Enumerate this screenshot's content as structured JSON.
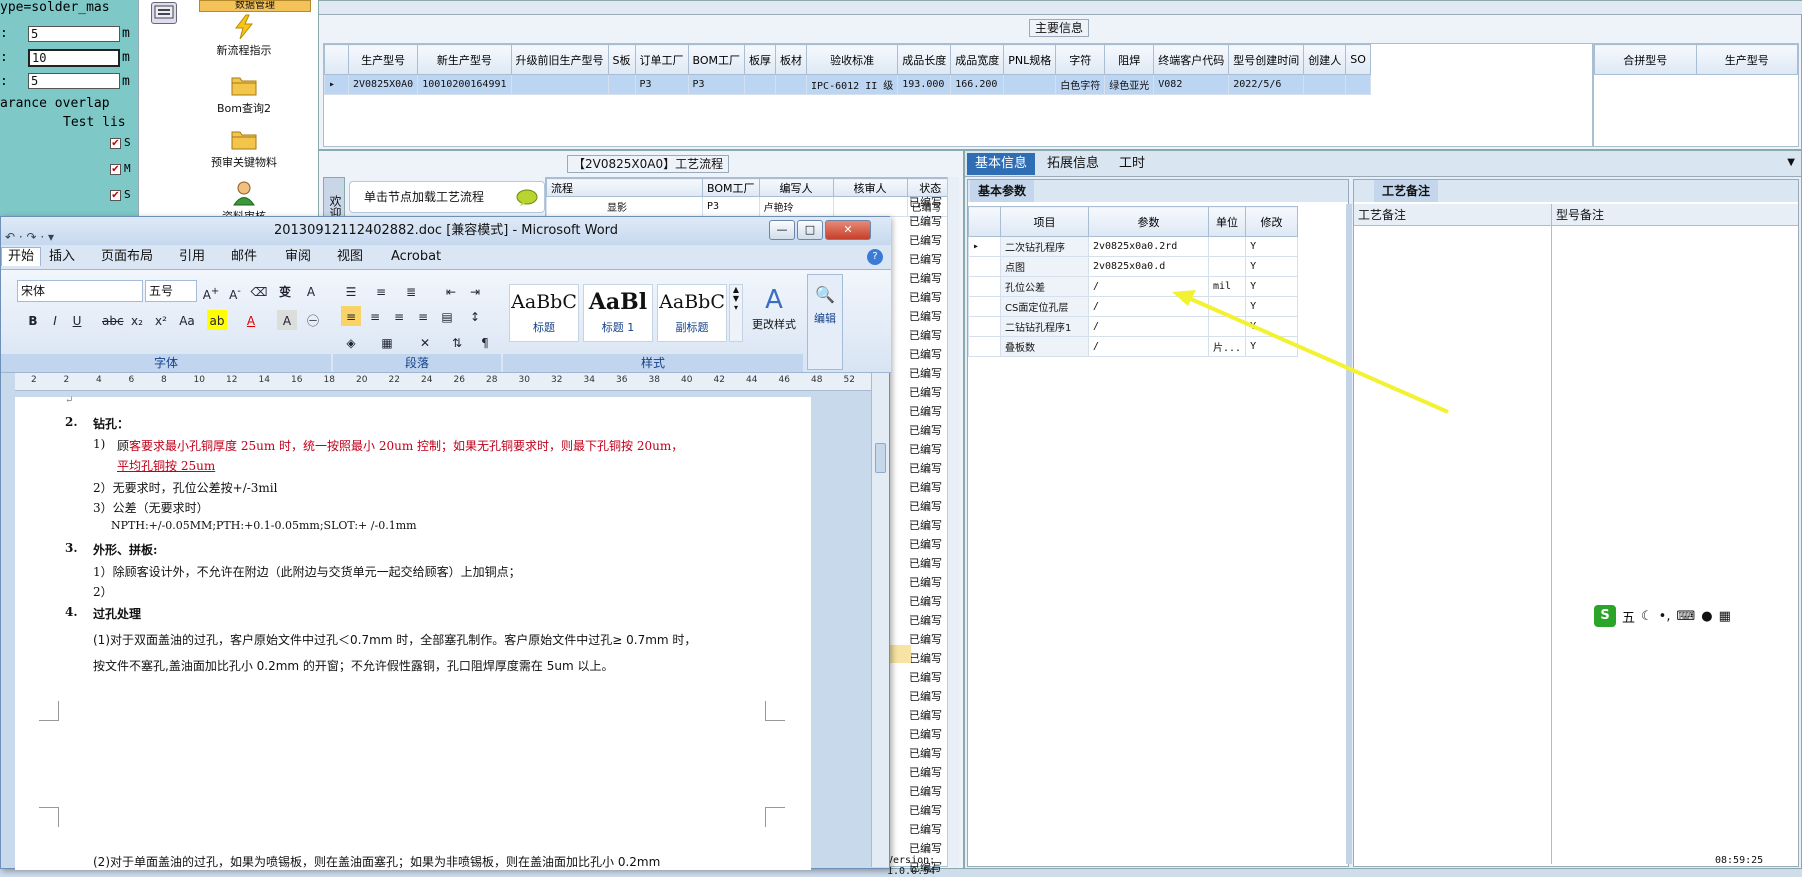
{
  "left_panel": {
    "top_line": "ype=solder_mas",
    "rows": [
      {
        "prefix": ":",
        "value": "5",
        "unit": "m"
      },
      {
        "prefix": ":",
        "value": "10",
        "unit": "m"
      },
      {
        "prefix": ":",
        "value": "5",
        "unit": "m"
      }
    ],
    "line_clearance": "arance overlap",
    "line_test": "Test lis",
    "checks": [
      "S",
      "M",
      "S"
    ]
  },
  "icon_column": {
    "header": "数据管理",
    "items": [
      "新流程指示",
      "Bom查询2",
      "预审关键物料",
      "资料审核"
    ]
  },
  "main_info": {
    "legend": "主要信息",
    "columns": [
      "生产型号",
      "新生产型号",
      "升级前旧生产型号",
      "S板",
      "订单工厂",
      "BOM工厂",
      "板厚",
      "板材",
      "验收标准",
      "成品长度",
      "成品宽度",
      "PNL规格",
      "字符",
      "阻焊",
      "终端客户代码",
      "型号创建时间",
      "创建人",
      "SO"
    ],
    "row": [
      "2V0825X0A0",
      "10010200164991",
      "",
      "",
      "P3",
      "P3",
      "",
      "",
      "IPC-6012 II 级",
      "193.000",
      "166.200",
      "",
      "白色字符",
      "绿色亚光",
      "V082",
      "2022/5/6",
      "",
      ""
    ],
    "side_columns": [
      "合拼型号",
      "生产型号"
    ]
  },
  "process": {
    "title": "【2V0825X0A0】工艺流程",
    "side_label": "欢迎",
    "load_button": "单击节点加载工艺流程",
    "columns": [
      "流程",
      "BOM工厂",
      "编写人",
      "核审人",
      "状态"
    ],
    "rows": [
      {
        "flow": "显影",
        "bom": "P3",
        "writer": "卢艳玲"
      }
    ],
    "status": "已编写",
    "version": "Version: 1.0.0.54"
  },
  "info_tabs": [
    "基本信息",
    "拓展信息",
    "工时"
  ],
  "basic_params": {
    "tab": "基本参数",
    "columns": [
      "项目",
      "参数",
      "单位",
      "修改"
    ],
    "rows": [
      {
        "item": "二次钻孔程序",
        "param": "2v0825x0a0.2rd",
        "unit": "",
        "edit": "Y"
      },
      {
        "item": "点图",
        "param": "2v0825x0a0.d",
        "unit": "",
        "edit": "Y"
      },
      {
        "item": "孔位公差",
        "param": "/",
        "unit": "mil",
        "edit": "Y"
      },
      {
        "item": "CS面定位孔层",
        "param": "/",
        "unit": "",
        "edit": "Y"
      },
      {
        "item": "二钻钻孔程序1",
        "param": "/",
        "unit": "",
        "edit": "Y"
      },
      {
        "item": "叠板数",
        "param": "/",
        "unit": "片...",
        "edit": "Y"
      }
    ]
  },
  "remarks": {
    "tab": "工艺备注",
    "col1": "工艺备注",
    "col2": "型号备注"
  },
  "ime_bar": {
    "logo": "S",
    "mode": "五"
  },
  "clock": "08:59:25",
  "word": {
    "title": "20130912112402882.doc [兼容模式] - Microsoft Word",
    "tabs": [
      "开始",
      "插入",
      "页面布局",
      "引用",
      "邮件",
      "审阅",
      "视图",
      "Acrobat"
    ],
    "font_name": "宋体",
    "font_size": "五号",
    "group_font": "字体",
    "group_paragraph": "段落",
    "group_styles": "样式",
    "styles": [
      {
        "preview": "AaBbC",
        "label": "标题"
      },
      {
        "preview": "AaBl",
        "label": "标题 1"
      },
      {
        "preview": "AaBbC",
        "label": "副标题"
      }
    ],
    "change_styles": "更改样式",
    "edit": "编辑",
    "ruler_numbers": [
      "2",
      "2",
      "4",
      "6",
      "8",
      "10",
      "12",
      "14",
      "16",
      "18",
      "20",
      "22",
      "24",
      "26",
      "28",
      "30",
      "32",
      "34",
      "36",
      "38",
      "40",
      "42",
      "44",
      "46",
      "48",
      "52"
    ],
    "doc": {
      "h2": "2.",
      "h2_text": "钻孔：",
      "l1_num": "1)",
      "l1_a": "顾",
      "l1_b": "客要求最小孔铜厚度 25um 时，统一按照最小 20um 控制；如果无孔铜要求时，则最下孔铜按 20um，",
      "l1_c": "平均孔铜按 25um",
      "l2": "2）无要求时，孔位公差按+/-3mil",
      "l3": "3）公差（无要求时）",
      "l4": "NPTH:+/-0.05MM;PTH:+0.1-0.05mm;SLOT:+ /-0.1mm",
      "h3": "3.",
      "h3_text": "外形、拼板:",
      "l5": "1）除顾客设计外，不允许在附边（此附边与交货单元一起交给顾客）上加铜点；",
      "l6": "2）",
      "h4": "4.",
      "h4_text": "过孔处理",
      "p1": "(1)对于双面盖油的过孔，客户原始文件中过孔＜0.7mm 时，全部塞孔制作。客户原始文件中过孔≥ 0.7mm 时，",
      "p2": "按文件不塞孔,盖油面加比孔小 0.2mm 的开窗；不允许假性露铜，孔口阻焊厚度需在 5um 以上。",
      "p3": "(2)对于单面盖油的过孔，如果为喷锡板，则在盖油面塞孔；如果为非喷锡板，则在盖油面加比孔小 0.2mm"
    }
  },
  "colors": {
    "arrow": "#f2f230",
    "selected_row": "#bcd5f2",
    "red_text": "#c0001a"
  }
}
